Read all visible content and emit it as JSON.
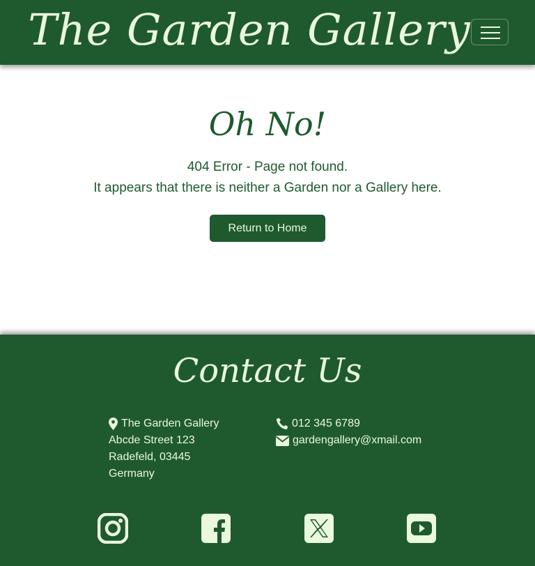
{
  "header": {
    "brand": "The Garden Gallery"
  },
  "error": {
    "title": "Oh No!",
    "line1": "404 Error - Page not found.",
    "line2": "It appears that there is neither a Garden nor a Gallery here.",
    "button": "Return to Home"
  },
  "footer": {
    "heading": "Contact Us",
    "address": {
      "name": "The Garden Gallery",
      "street": "Abcde Street 123",
      "city": "Radefeld, 03445",
      "country": "Germany"
    },
    "phone": "012 345 6789",
    "email": "gardengallery@xmail.com",
    "social": [
      "instagram-icon",
      "facebook-icon",
      "x-icon",
      "youtube-icon"
    ]
  },
  "colors": {
    "primary": "#1f5a2e",
    "light": "#eaf8dc"
  }
}
